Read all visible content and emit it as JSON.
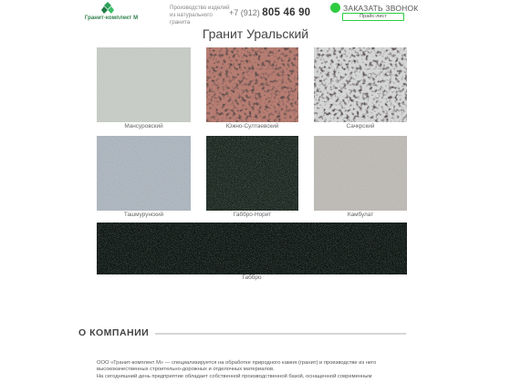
{
  "header": {
    "logo_text": "Гранит-комплект М",
    "tagline": "Производство изделий из натурального гранита",
    "phone_prefix": "+7 (912)",
    "phone_number": "805 46 90",
    "callback_label": "ЗАКАЗАТЬ ЗВОНОК",
    "pricelist_label": "Прайс-лист"
  },
  "page": {
    "title": "Гранит Уральский"
  },
  "granites": [
    {
      "name": "Мансуровский"
    },
    {
      "name": "Южно-Султаевский"
    },
    {
      "name": "Сачкрский"
    },
    {
      "name": "Ташмурунский"
    },
    {
      "name": "Габбро-Норит"
    },
    {
      "name": "Камбулат"
    },
    {
      "name": "Габбро"
    }
  ],
  "about": {
    "title": "О КОМПАНИИ",
    "line1": "ООО «Гранит-комплект М» — специализируется на обработке природного камня (гранит) и производстве из него",
    "line2": "высококачественных строительно-дорожных и отделочных материалов.",
    "line3": "На сегодняшний день предприятие обладает собственной производственной базой, оснащенной современным"
  },
  "colors": {
    "accent": "#2ecc40",
    "brand": "#2e7d4a"
  }
}
